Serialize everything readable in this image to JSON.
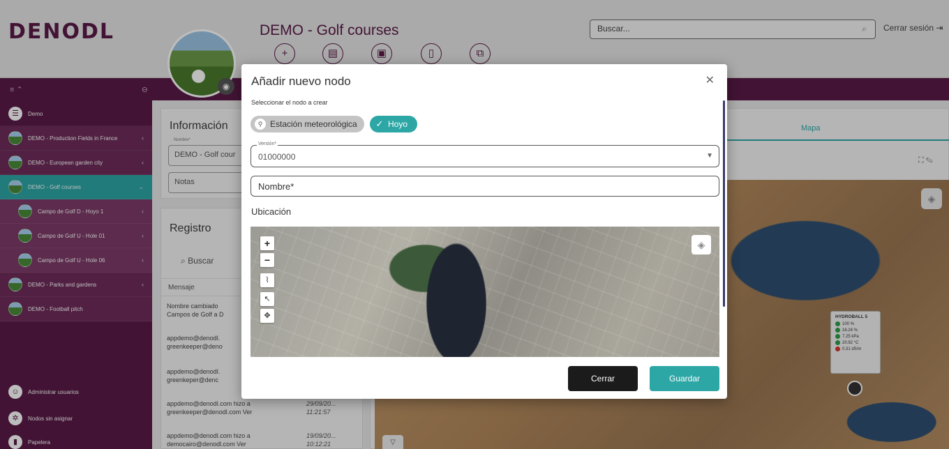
{
  "header": {
    "logo": "DENODL",
    "title": "DEMO - Golf courses",
    "toolbar_icons": [
      "plus-icon",
      "report-icon",
      "briefcase-icon",
      "trash-icon",
      "copy-icon"
    ],
    "search_placeholder": "Buscar...",
    "logout_label": "Cerrar sesión"
  },
  "sidebar": {
    "items": [
      {
        "label": "Demo",
        "level": "root"
      },
      {
        "label": "DEMO - Production Fields in France",
        "level": "top"
      },
      {
        "label": "DEMO - European garden city",
        "level": "top"
      },
      {
        "label": "DEMO - Golf courses",
        "level": "top",
        "active": true
      },
      {
        "label": "Campo de Golf D - Hoyo 1",
        "level": "sub"
      },
      {
        "label": "Campo de Golf U - Hole 01",
        "level": "sub"
      },
      {
        "label": "Campo de Golf U - Hole 06",
        "level": "sub"
      },
      {
        "label": "DEMO - Parks and gardens",
        "level": "top"
      },
      {
        "label": "DEMO - Football pitch",
        "level": "top"
      }
    ],
    "bottom": [
      {
        "label": "Administrar usuarios"
      },
      {
        "label": "Nodos sin asignar"
      },
      {
        "label": "Papelera"
      }
    ]
  },
  "info_card": {
    "title": "Información",
    "name_label": "Nombre*",
    "name_value": "DEMO - Golf cour",
    "notes_placeholder": "Notas"
  },
  "registro_card": {
    "title": "Registro",
    "search_placeholder": "Buscar",
    "column_header": "Mensaje",
    "rows": [
      {
        "text1": "Nombre cambiado",
        "text2": "Campos de Golf a D",
        "date": "",
        "time": ""
      },
      {
        "text1": "appdemo@denodl.",
        "text2": "greenkeeper@deno",
        "date": "",
        "time": ""
      },
      {
        "text1": "appdemo@denodl.",
        "text2": "greenkeper@denc",
        "date": "",
        "time": ""
      },
      {
        "text1": "appdemo@denodl.com hizo a",
        "text2": "greenkeeper@denodl.com Ver",
        "date": "29/09/20...",
        "time": "11:21:57"
      },
      {
        "text1": "appdemo@denodl.com hizo a",
        "text2": "democairo@denodl.com Ver",
        "date": "19/09/20...",
        "time": "10:12:21"
      }
    ]
  },
  "map_panel": {
    "tab_label": "Mapa",
    "sensor": {
      "name": "HYDROBALL 5",
      "readings": [
        {
          "value": "100 %",
          "color": "#2e9e4a"
        },
        {
          "value": "16.24 %",
          "color": "#2e9e4a"
        },
        {
          "value": "7.25 kPa",
          "color": "#2e9e4a"
        },
        {
          "value": "20.92 °C",
          "color": "#2e9e4a"
        },
        {
          "value": "0.31 dS/m",
          "color": "#d9342b"
        }
      ]
    }
  },
  "modal": {
    "title": "Añadir nuevo nodo",
    "subtitle": "Seleccionar el nodo a crear",
    "options": [
      {
        "label": "Estación meteorológica",
        "selected": false
      },
      {
        "label": "Hoyo",
        "selected": true
      }
    ],
    "version_label": "Versión*",
    "version_value": "01000000",
    "name_placeholder": "Nombre*",
    "location_label": "Ubicación",
    "map_controls": {
      "zoom_in": "+",
      "zoom_out": "−"
    },
    "buttons": {
      "close": "Cerrar",
      "save": "Guardar"
    }
  },
  "colors": {
    "brand_purple": "#5a1a47",
    "teal_accent": "#2da7a6",
    "dark_button": "#1b1b1b"
  }
}
